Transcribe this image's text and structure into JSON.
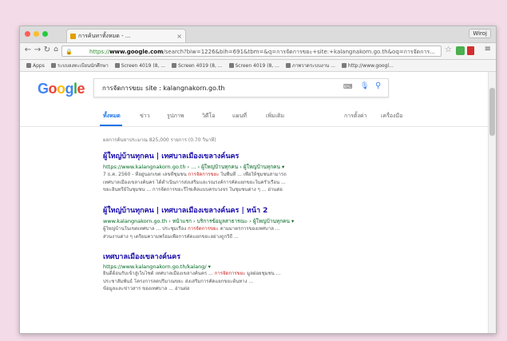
{
  "browser": {
    "tab_title": "การค้นหาทั้งหมด - ...",
    "profile_label": "Wiroj",
    "url_scheme": "https://",
    "url_domain": "www.google.com",
    "url_rest": "/search?biw=1226&bih=691&tbm=&q=การจัดการขยะ+site:+kalangnakorn.go.th&oq=การจัดการ...",
    "bookmarks": [
      "Apps",
      "ระบบลงทะเบียนนักศึกษา",
      "Screen 4019 (8, ...",
      "Screen 4019 (8, ...",
      "Screen 4019 (8, ...",
      "ภาพวาดระบบงาน ...",
      "http://www.googl..."
    ]
  },
  "google": {
    "logo": "Google",
    "query": "การจัดการขยะ site : kalangnakorn.go.th",
    "tabs": [
      "ทั้งหมด",
      "ข่าว",
      "รูปภาพ",
      "วิดีโอ",
      "แผนที่",
      "เพิ่มเติม",
      "การตั้งค่า",
      "เครื่องมือ"
    ],
    "result_stats": "ผลการค้นหาประมาณ 825,000 รายการ (0.70 วินาที)",
    "results": [
      {
        "title": "ผู้ใหญ่บ้านทุกคน | เทศบาลเมืองเขลางค์นคร",
        "url": "https://www.kalangnakorn.go.th › ... › ผู้ใหญ่บ้านทุกคน › ผู้ใหญ่บ้านทุกคน ▾",
        "snip1_a": "7 ธ.ค. 2560 - ที่อยู่นอกเขต เลขที่ชุมชน ",
        "snip1_hl": "การจัดการขยะ",
        "snip1_b": " ในพื้นที่ ... เพื่อให้ชุมชนสามารถ",
        "snip2": "เทศบาลเมืองเขลางค์นคร ได้ดำเนินการส่งเสริมและรณรงค์การคัดแยกขยะในครัวเรือน ...",
        "snip3": "ขยะอินทรีย์ในชุมชน ... การจัดการขยะรีไซเคิลแบบครบวงจร ในชุมชนต่าง ๆ ... อ่านต่อ"
      },
      {
        "title": "ผู้ใหญ่บ้านทุกคน | เทศบาลเมืองเขลางค์นคร | หน้า 2",
        "url": "www.kalangnakorn.go.th › หน้าแรก › บริการข้อมูลสาธารณะ › ผู้ใหญ่บ้านทุกคน ▾",
        "snip1_a": "ผู้ใหญ่บ้านในเขตเทศบาล ... ประชุมเรื่อง ",
        "snip1_hl": "การจัดการขยะ",
        "snip1_b": " ตามมาตรการของเทศบาล ...",
        "snip2": "ส่วนงานต่าง ๆ เตรียมความพร้อมเพื่อการคัดแยกขยะอย่างถูกวิธี ..."
      },
      {
        "title": "เทศบาลเมืองเขลางค์นคร",
        "url": "https://www.kalangnakorn.go.th/kalang/ ▾",
        "snip1_a": "ยินดีต้อนรับเข้าสู่เว็บไซต์ เทศบาลเมืองเขลางค์นคร ... ",
        "snip1_hl": "การจัดการขยะ",
        "snip1_b": " มูลฝอยชุมชน ...",
        "snip2": "ประชาสัมพันธ์ โครงการลดปริมาณขยะ ส่งเสริมการคัดแยกขยะต้นทาง ...",
        "snip3": "ข้อมูลและข่าวสาร ของเทศบาล ... อ่านต่อ"
      }
    ]
  },
  "colors": {
    "g_blue": "#4285F4",
    "g_red": "#EA4335",
    "g_yellow": "#FBBC05",
    "g_green": "#34A853"
  },
  "icons": [
    "close-dot-icon",
    "minimize-dot-icon",
    "maximize-dot-icon",
    "back-arrow-icon",
    "forward-arrow-icon",
    "reload-icon",
    "home-icon",
    "lock-icon",
    "star-icon",
    "extension-icon",
    "menu-icon",
    "keyboard-icon",
    "microphone-icon",
    "search-icon"
  ]
}
